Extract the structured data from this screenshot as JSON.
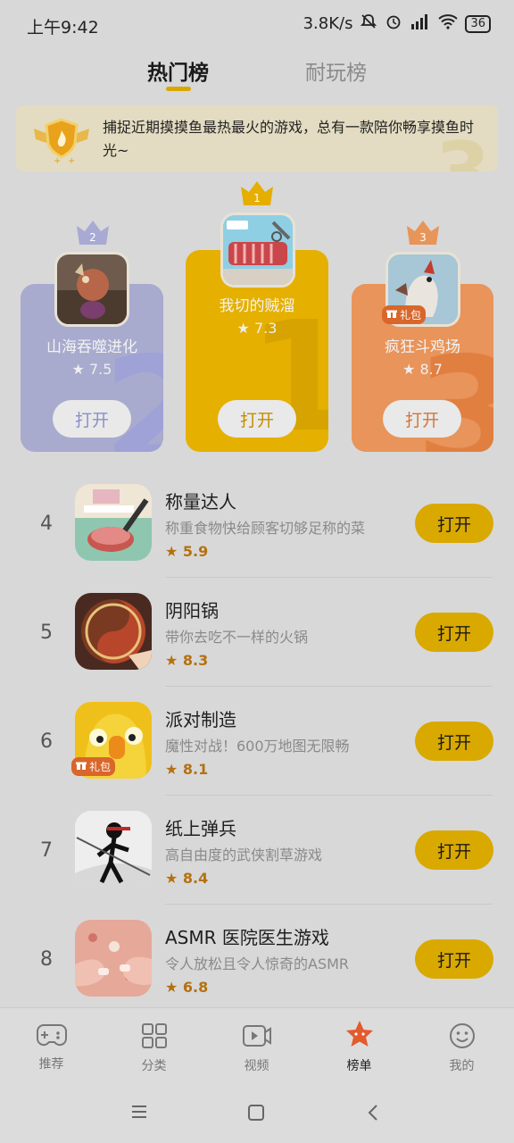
{
  "status": {
    "time": "上午9:42",
    "speed": "3.8K/s",
    "battery": "36"
  },
  "tabs": [
    {
      "label": "热门榜"
    },
    {
      "label": "耐玩榜"
    }
  ],
  "banner": {
    "text": "捕捉近期摸摸鱼最热最火的游戏，总有一款陪你畅享摸鱼时光~",
    "bg_number": "3"
  },
  "podium": [
    {
      "rank": "2",
      "name": "山海吞噬进化",
      "rating": "7.5",
      "open": "打开"
    },
    {
      "rank": "1",
      "name": "我切的贼溜",
      "rating": "7.3",
      "open": "打开"
    },
    {
      "rank": "3",
      "name": "疯狂斗鸡场",
      "rating": "8.7",
      "open": "打开",
      "badge": "礼包"
    }
  ],
  "list": [
    {
      "rank": "4",
      "name": "称量达人",
      "desc": "称重食物快给顾客切够足称的菜",
      "rating": "5.9",
      "open": "打开"
    },
    {
      "rank": "5",
      "name": "阴阳锅",
      "desc": "带你去吃不一样的火锅",
      "rating": "8.3",
      "open": "打开"
    },
    {
      "rank": "6",
      "name": "派对制造",
      "desc": "魔性对战！600万地图无限畅",
      "rating": "8.1",
      "open": "打开",
      "badge": "礼包"
    },
    {
      "rank": "7",
      "name": "纸上弹兵",
      "desc": "高自由度的武侠割草游戏",
      "rating": "8.4",
      "open": "打开"
    },
    {
      "rank": "8",
      "name": "ASMR 医院医生游戏",
      "desc": "令人放松且令人惊奇的ASMR",
      "rating": "6.8",
      "open": "打开"
    }
  ],
  "nav": [
    {
      "label": "推荐",
      "icon": "gamepad-icon"
    },
    {
      "label": "分类",
      "icon": "grid-icon"
    },
    {
      "label": "视频",
      "icon": "video-icon"
    },
    {
      "label": "榜单",
      "icon": "star-icon"
    },
    {
      "label": "我的",
      "icon": "smiley-icon"
    }
  ],
  "colors": {
    "accent": "#d9a900",
    "silver_card": "#a7aacf",
    "gold_card": "#e6b000",
    "bronze_card": "#e8955a",
    "rating": "#b5710f"
  }
}
